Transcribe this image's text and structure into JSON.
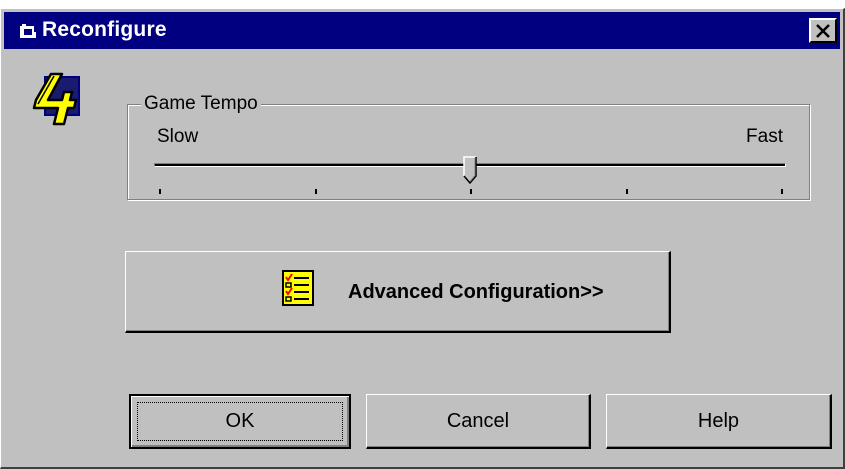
{
  "window": {
    "title": "Reconfigure",
    "title_icon": "app-small-icon",
    "close_glyph": "✕"
  },
  "app_icon": {
    "name": "game-4-icon",
    "glyph": "4"
  },
  "tempo": {
    "group_label": "Game Tempo",
    "min_label": "Slow",
    "max_label": "Fast",
    "value": 0.5,
    "tick_count": 5
  },
  "advanced_button": {
    "label": "Advanced Configuration>>",
    "icon": "checklist-icon"
  },
  "buttons": {
    "ok": "OK",
    "cancel": "Cancel",
    "help": "Help"
  },
  "colors": {
    "titlebar": "#000080",
    "face": "#c0c0c0",
    "icon_yellow": "#ffff00"
  }
}
